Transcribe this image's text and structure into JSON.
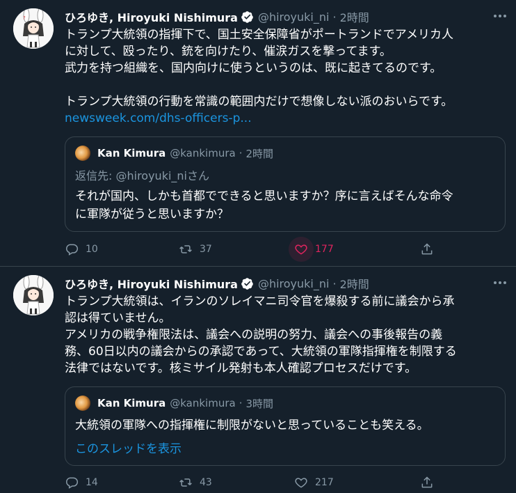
{
  "colors": {
    "background": "#15202b",
    "border": "#38444d",
    "muted_text": "#8899a6",
    "link": "#1b95e0",
    "like_active": "#e0245e",
    "verified_badge": "#ffffff"
  },
  "tweets": [
    {
      "author": {
        "name": "ひろゆき, Hiroyuki Nishimura",
        "handle": "@hiroyuki_ni",
        "separator": "·",
        "time": "2時間",
        "verified": true,
        "avatar_icon": "rabbit-girl-avatar"
      },
      "text_lines": [
        "トランプ大統領の指揮下で、国土安全保障省がポートランドでアメリカ人",
        "に対して、殴ったり、銃を向けたり、催涙ガスを撃ってます。",
        "武力を持つ組織を、国内向けに使うというのは、既に起きてるのです。",
        "",
        "トランプ大統領の行動を常識の範囲内だけで想像しない派のおいらです。"
      ],
      "link": "newsweek.com/dhs-officers-p...",
      "quote": {
        "name": "Kan Kimura",
        "handle": "@kankimura",
        "separator": "·",
        "time": "2時間",
        "reply_to": "返信先: @hiroyuki_niさん",
        "text_lines": [
          "それが国内、しかも首都でできると思いますか？序に言えばそんな命令",
          "に軍隊が従うと思いますか？"
        ],
        "show_thread": ""
      },
      "stats": {
        "replies": "10",
        "retweets": "37",
        "likes": "177"
      },
      "liked": true
    },
    {
      "author": {
        "name": "ひろゆき, Hiroyuki Nishimura",
        "handle": "@hiroyuki_ni",
        "separator": "·",
        "time": "2時間",
        "verified": true,
        "avatar_icon": "rabbit-girl-avatar"
      },
      "text_lines": [
        "トランプ大統領は、イランのソレイマニ司令官を爆殺する前に議会から承",
        "認は得ていません。",
        "アメリカの戦争権限法は、議会への説明の努力、議会への事後報告の義",
        "務、60日以内の議会からの承認であって、大統領の軍隊指揮権を制限する",
        "法律ではないです。核ミサイル発射も本人確認プロセスだけです。"
      ],
      "link": "",
      "quote": {
        "name": "Kan Kimura",
        "handle": "@kankimura",
        "separator": "·",
        "time": "3時間",
        "reply_to": "",
        "text_lines": [
          "大統領の軍隊への指揮権に制限がないと思っていることも笑える。"
        ],
        "show_thread": "このスレッドを表示"
      },
      "stats": {
        "replies": "14",
        "retweets": "43",
        "likes": "217"
      },
      "liked": false
    }
  ]
}
